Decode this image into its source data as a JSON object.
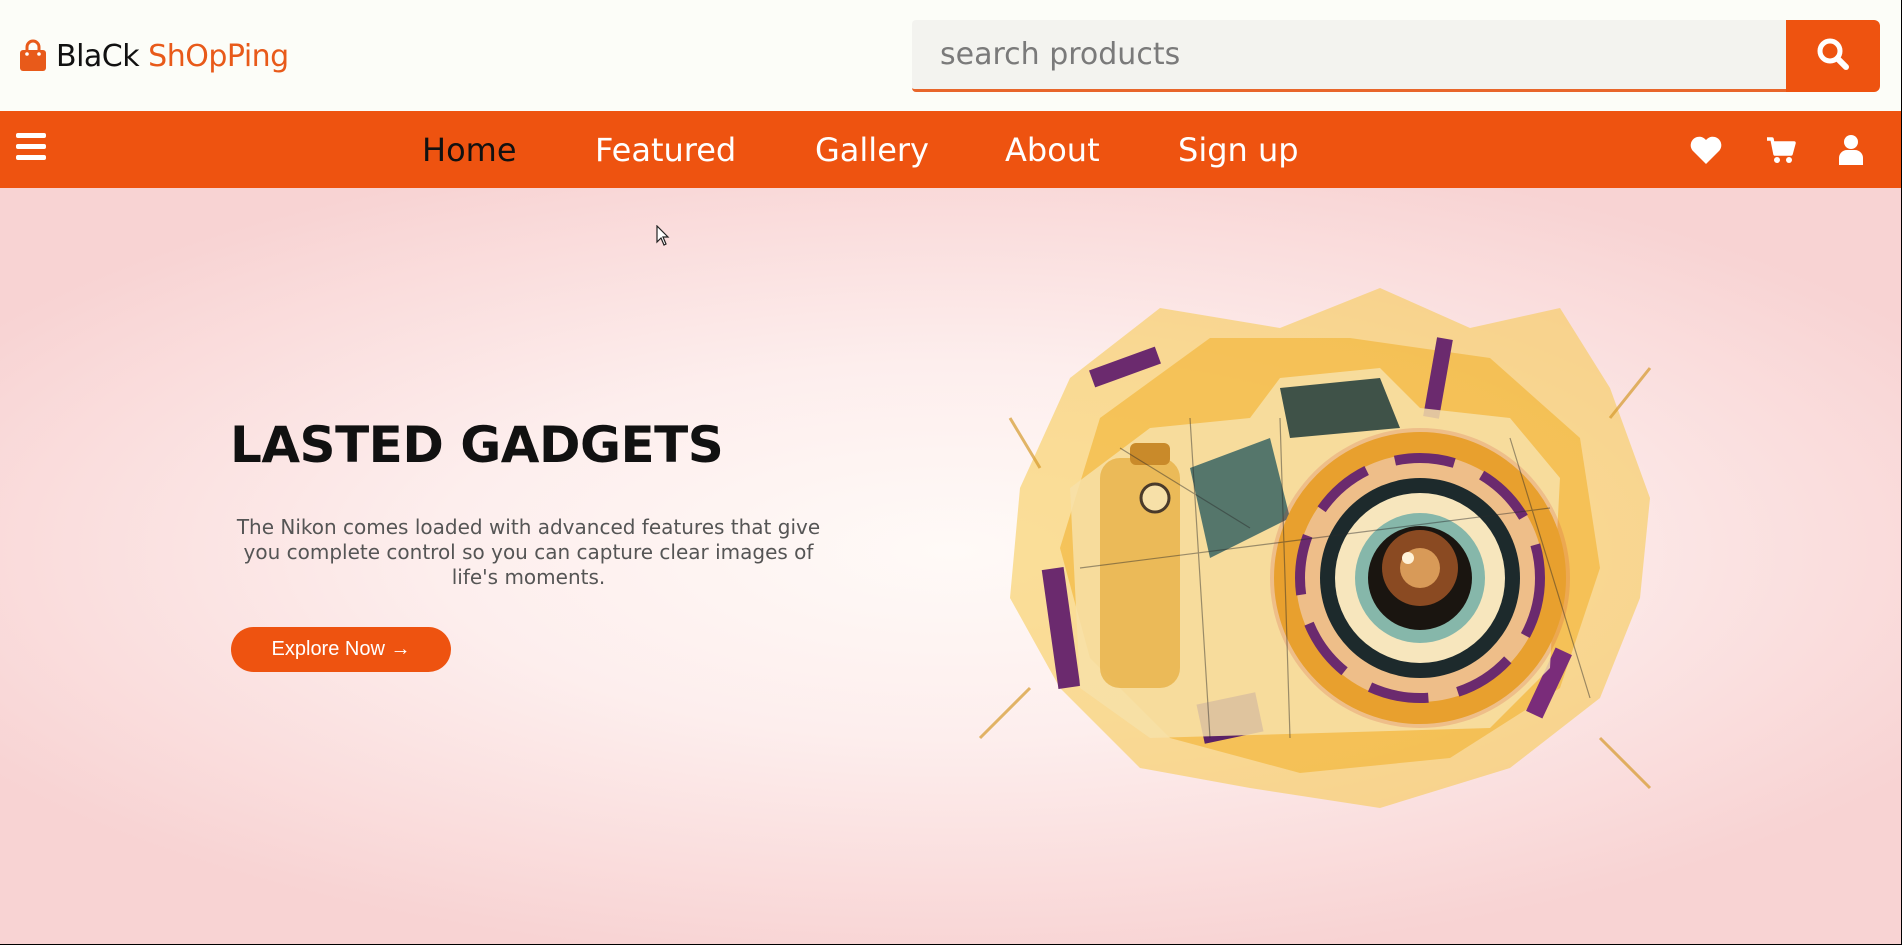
{
  "header": {
    "logo_part1": "BlaCk",
    "logo_part2": "ShOpPing",
    "search_placeholder": "search products",
    "search_icon": "search-icon"
  },
  "nav": {
    "menu_icon": "hamburger-menu-icon",
    "links": [
      {
        "label": "Home",
        "active": true
      },
      {
        "label": "Featured",
        "active": false
      },
      {
        "label": "Gallery",
        "active": false
      },
      {
        "label": "About",
        "active": false
      },
      {
        "label": "Sign up",
        "active": false
      }
    ],
    "icons": [
      "heart-icon",
      "cart-icon",
      "user-icon"
    ]
  },
  "hero": {
    "title": "LASTED GADGETS",
    "description": "The Nikon comes loaded with advanced features that give you complete control so you can capture clear images of life's moments.",
    "button_label": "Explore Now →",
    "image": "watercolor-camera-illustration"
  },
  "colors": {
    "accent": "#ee5310",
    "header_bg": "#fcfdf8",
    "hero_bg": "#f8d3d3"
  }
}
